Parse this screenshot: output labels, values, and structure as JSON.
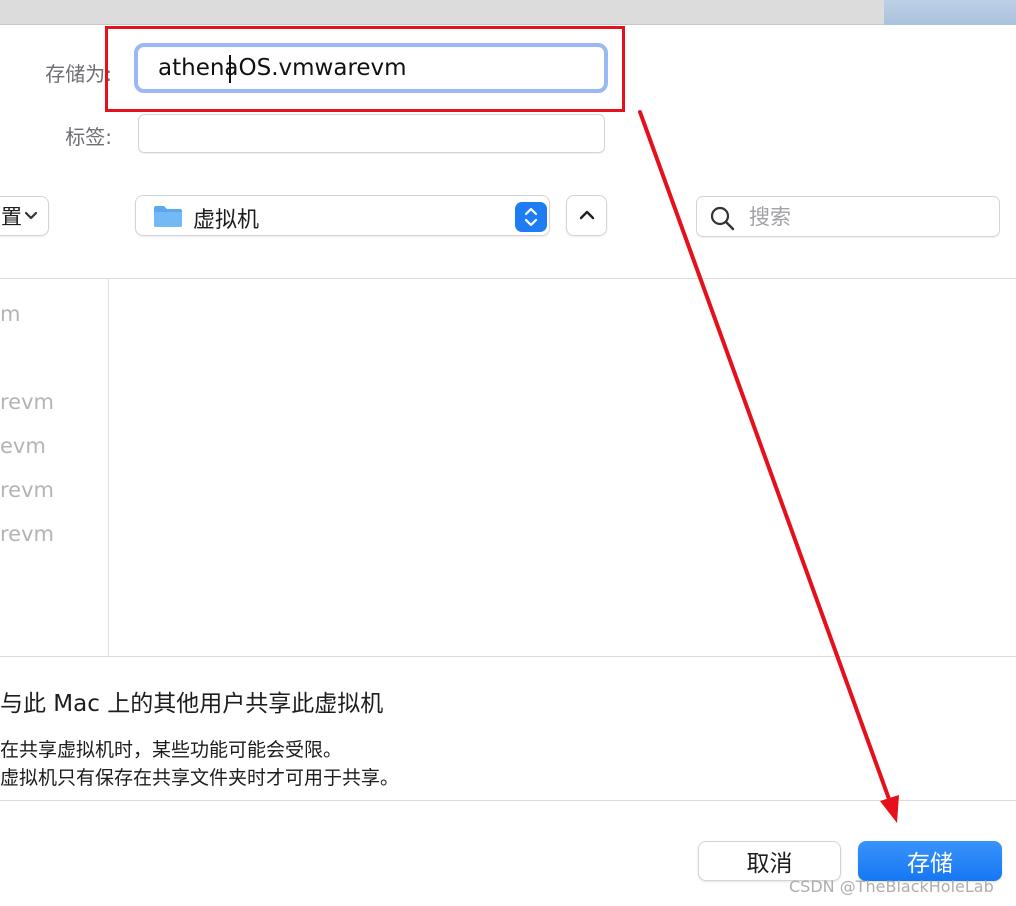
{
  "save_as": {
    "label": "存储为:",
    "value": "athenaOS.vmwarevm"
  },
  "tags": {
    "label": "标签:",
    "value": ""
  },
  "toolbar": {
    "view_label": "置",
    "location": "虚拟机",
    "search_placeholder": "搜索"
  },
  "files": [
    "m",
    "revm",
    "evm",
    "revm",
    "revm"
  ],
  "sharing": {
    "title": "与此 Mac 上的其他用户共享此虚拟机",
    "notes": [
      "在共享虚拟机时，某些功能可能会受限。",
      "虚拟机只有保存在共享文件夹时才可用于共享。"
    ]
  },
  "buttons": {
    "cancel": "取消",
    "save": "存储"
  },
  "watermark": "CSDN @TheBlackHoleLab",
  "colors": {
    "accent": "#1e7cf5",
    "annotation": "#e5101b",
    "focus_ring": "#9ab8f5"
  }
}
